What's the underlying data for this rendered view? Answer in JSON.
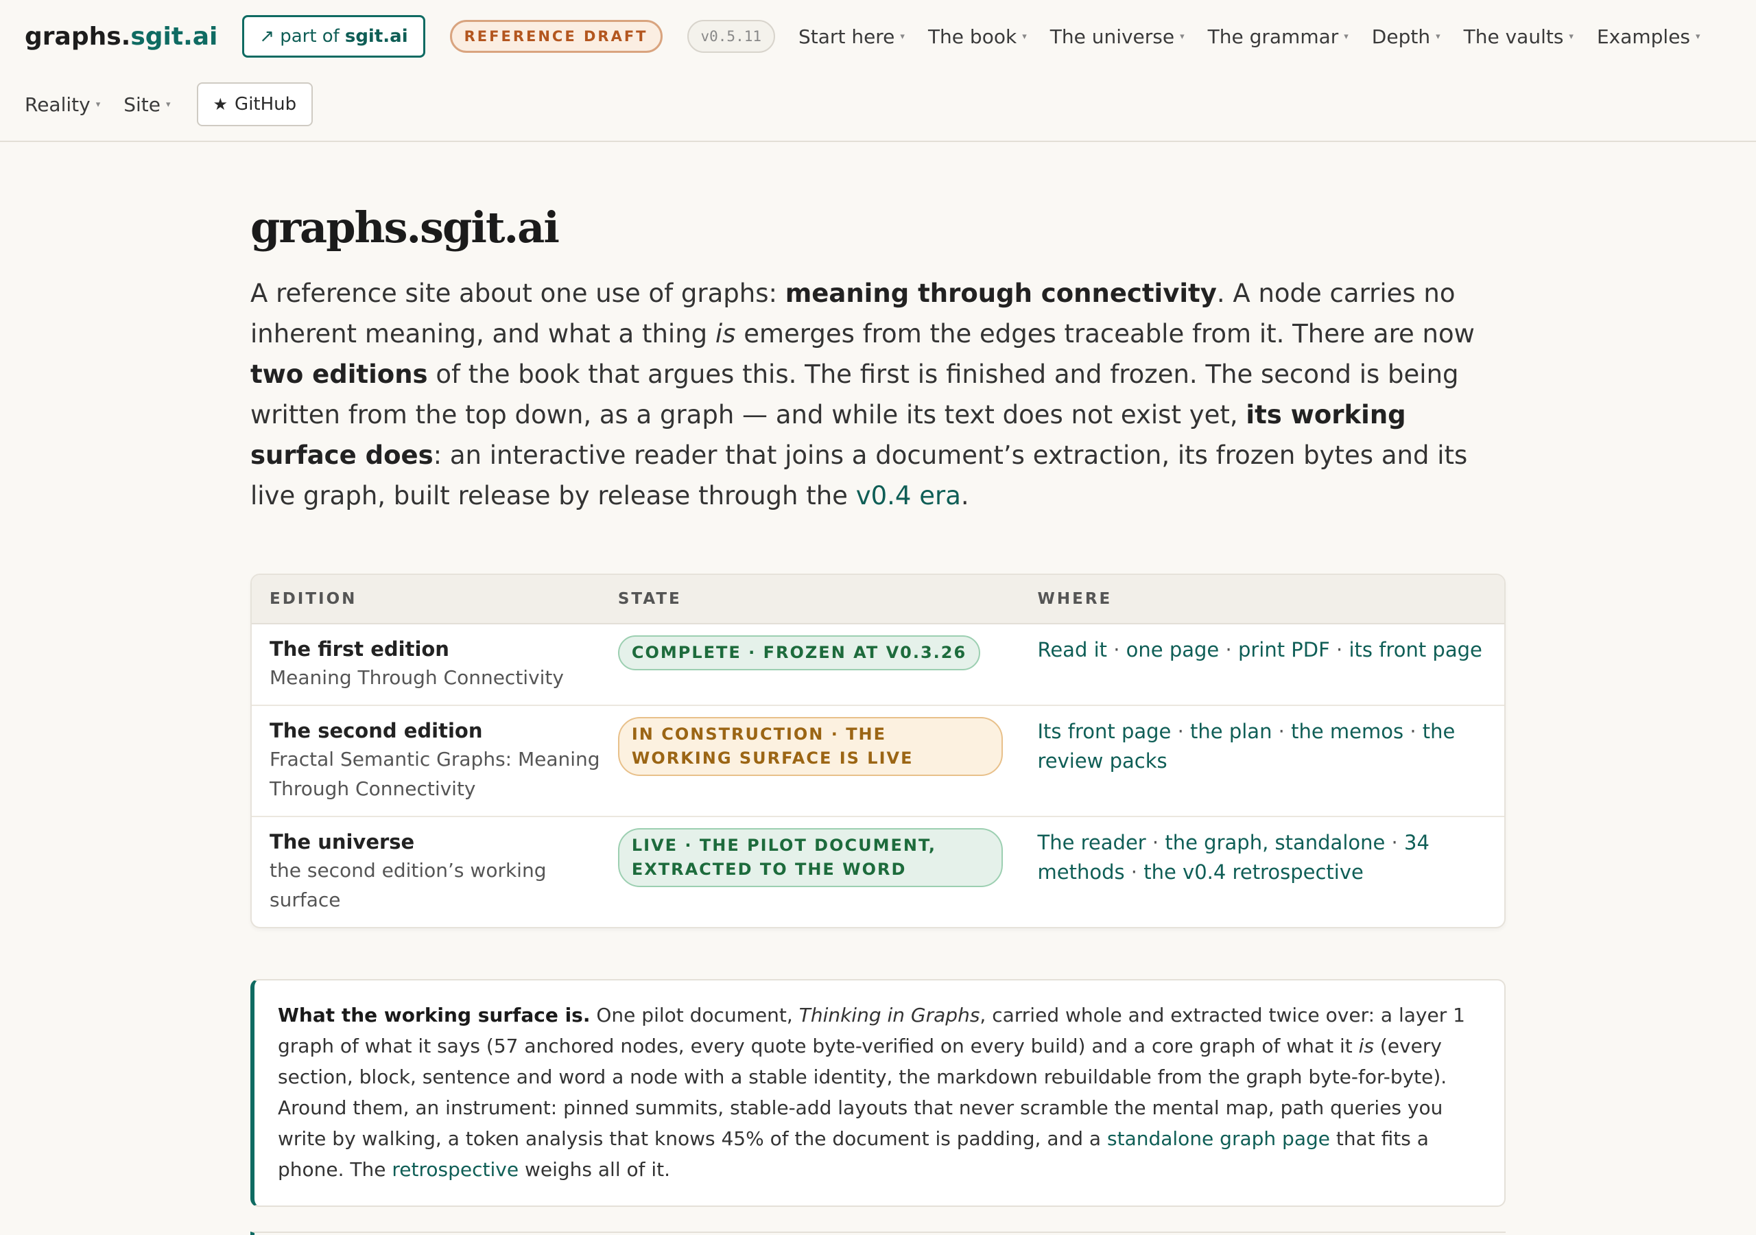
{
  "header": {
    "brand_main": "graphs.",
    "brand_accent": "sgit.ai",
    "partof_arrow": "↗",
    "partof_text": "part of",
    "partof_strong": "sgit.ai",
    "draft_badge": "REFERENCE DRAFT",
    "version": "v0.5.11",
    "nav": [
      {
        "label": "Start here"
      },
      {
        "label": "The book"
      },
      {
        "label": "The universe"
      },
      {
        "label": "The grammar"
      },
      {
        "label": "Depth"
      },
      {
        "label": "The vaults"
      },
      {
        "label": "Examples"
      },
      {
        "label": "Reality"
      },
      {
        "label": "Site"
      }
    ],
    "caret": "▾",
    "github_star": "★",
    "github_label": "GitHub"
  },
  "main": {
    "title": "graphs.sgit.ai",
    "lede": {
      "p1": "A reference site about one use of graphs: ",
      "b1": "meaning through connectivity",
      "p2": ". A node carries no inherent meaning, and what a thing ",
      "i1": "is",
      "p3": " emerges from the edges traceable from it. There are now ",
      "b2": "two editions",
      "p4": " of the book that argues this. The first is finished and frozen. The second is being written from the top down, as a graph — and while its text does not exist yet, ",
      "b3": "its working surface does",
      "p5": ": an interactive reader that joins a document’s extraction, its frozen bytes and its live graph, built release by release through the ",
      "link": "v0.4 era",
      "p6": "."
    },
    "table": {
      "headers": [
        "EDITION",
        "STATE",
        "WHERE"
      ],
      "rows": [
        {
          "name": "The first edition",
          "sub": "Meaning Through Connectivity",
          "state": "COMPLETE · FROZEN AT V0.3.26",
          "links": [
            "Read it",
            "one page",
            "print PDF",
            "its front page"
          ]
        },
        {
          "name": "The second edition",
          "sub": "Fractal Semantic Graphs: Meaning Through Connectivity",
          "state": "IN CONSTRUCTION · THE WORKING SURFACE IS LIVE",
          "links": [
            "Its front page",
            "the plan",
            "the memos",
            "the review packs"
          ]
        },
        {
          "name": "The universe",
          "sub": "the second edition’s working surface",
          "state": "LIVE · THE PILOT DOCUMENT, EXTRACTED TO THE WORD",
          "links": [
            "The reader",
            "the graph, standalone",
            "34 methods",
            "the v0.4 retrospective"
          ]
        }
      ],
      "separator": " · "
    },
    "callout": {
      "lead": "What the working surface is.",
      "t1": " One pilot document, ",
      "i1": "Thinking in Graphs",
      "t2": ", carried whole and extracted twice over: a layer 1 graph of what it says (57 anchored nodes, every quote byte-verified on every build) and a core graph of what it ",
      "i2": "is",
      "t3": " (every section, block, sentence and word a node with a stable identity, the markdown rebuildable from the graph byte-for-byte). Around them, an instrument: pinned summits, stable-add layouts that never scramble the mental map, path queries you write by walking, a token analysis that knows 45% of the document is padding, and a ",
      "link1": "standalone graph page",
      "t4": " that fits a phone. The ",
      "link2": "retrospective",
      "t5": " weighs all of it."
    }
  }
}
